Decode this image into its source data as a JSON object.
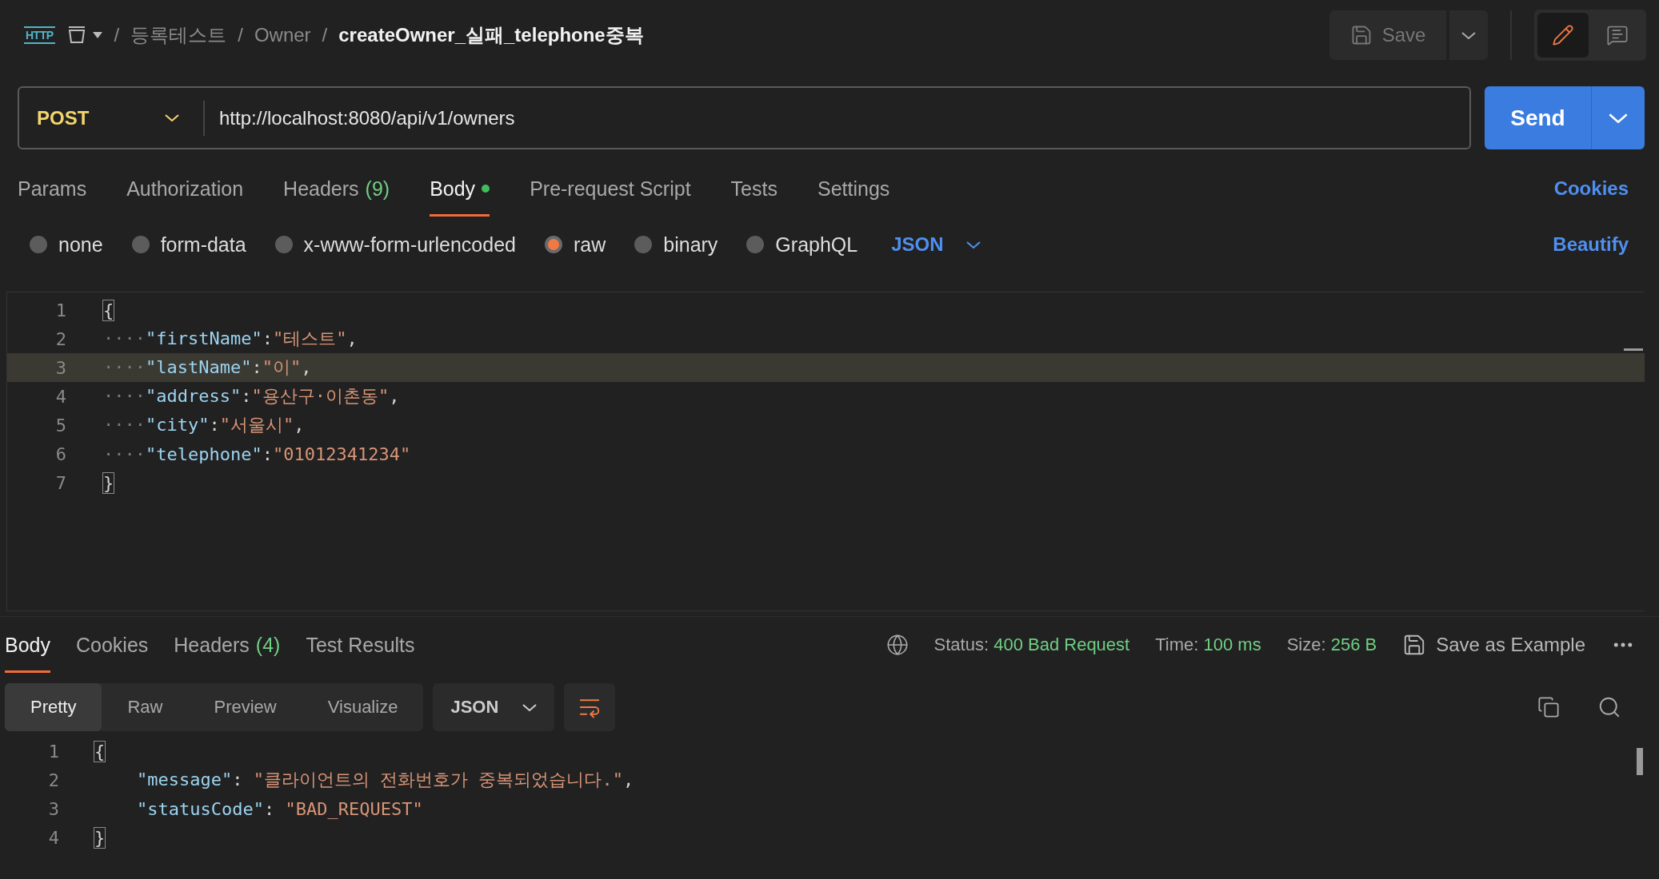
{
  "request_kind": "HTTP",
  "breadcrumb": {
    "separator": "/",
    "parts": [
      "등록테스트",
      "Owner"
    ],
    "current": "createOwner_실패_telephone중복"
  },
  "save_button": {
    "label": "Save",
    "disabled": true
  },
  "mode_toggle": [
    {
      "kind": "edit",
      "selected": true
    },
    {
      "kind": "comments",
      "selected": false
    }
  ],
  "request": {
    "method": "POST",
    "url": "http://localhost:8080/api/v1/owners"
  },
  "send_button": "Send",
  "request_tabs": [
    {
      "label": "Params",
      "selected": false
    },
    {
      "label": "Authorization",
      "selected": false
    },
    {
      "label": "Headers",
      "count": "(9)",
      "selected": false
    },
    {
      "label": "Body",
      "selected": true,
      "has_content": true
    },
    {
      "label": "Pre-request Script",
      "selected": false
    },
    {
      "label": "Tests",
      "selected": false
    },
    {
      "label": "Settings",
      "selected": false
    }
  ],
  "cookies_link": "Cookies",
  "body_types": [
    {
      "label": "none",
      "selected": false
    },
    {
      "label": "form-data",
      "selected": false
    },
    {
      "label": "x-www-form-urlencoded",
      "selected": false
    },
    {
      "label": "raw",
      "selected": true
    },
    {
      "label": "binary",
      "selected": false
    },
    {
      "label": "GraphQL",
      "selected": false
    }
  ],
  "raw_language": "JSON",
  "beautify_link": "Beautify",
  "request_body": [
    {
      "number": "1",
      "text": "{",
      "highlighted": false,
      "bracket_match": true
    },
    {
      "number": "2",
      "text": "····\"firstName\":\"테스트\",",
      "highlighted": false
    },
    {
      "number": "3",
      "text": "····\"lastName\":\"이\",",
      "highlighted": true
    },
    {
      "number": "4",
      "text": "····\"address\":\"용산구·이촌동\",",
      "highlighted": false
    },
    {
      "number": "5",
      "text": "····\"city\":\"서울시\",",
      "highlighted": false
    },
    {
      "number": "6",
      "text": "····\"telephone\":\"01012341234\"",
      "highlighted": false
    },
    {
      "number": "7",
      "text": "}",
      "highlighted": false,
      "bracket_match": true
    }
  ],
  "response_tabs": [
    {
      "label": "Body",
      "selected": true
    },
    {
      "label": "Cookies",
      "selected": false
    },
    {
      "label": "Headers",
      "count": "(4)",
      "selected": false
    },
    {
      "label": "Test Results",
      "selected": false
    }
  ],
  "response_meta": [
    {
      "label": "Status:",
      "value": "400 Bad Request"
    },
    {
      "label": "Time:",
      "value": "100 ms"
    },
    {
      "label": "Size:",
      "value": "256 B"
    }
  ],
  "save_example": "Save as Example",
  "view_modes": [
    {
      "label": "Pretty",
      "selected": true
    },
    {
      "label": "Raw",
      "selected": false
    },
    {
      "label": "Preview",
      "selected": false
    },
    {
      "label": "Visualize",
      "selected": false
    }
  ],
  "response_format": "JSON",
  "response_body": [
    {
      "number": "1",
      "text": "{",
      "bracket_match": true
    },
    {
      "number": "2",
      "text": "    \"message\": \"클라이언트의 전화번호가 중복되었습니다.\","
    },
    {
      "number": "3",
      "text": "    \"statusCode\": \"BAD_REQUEST\""
    },
    {
      "number": "4",
      "text": "}",
      "bracket_match": true
    }
  ]
}
